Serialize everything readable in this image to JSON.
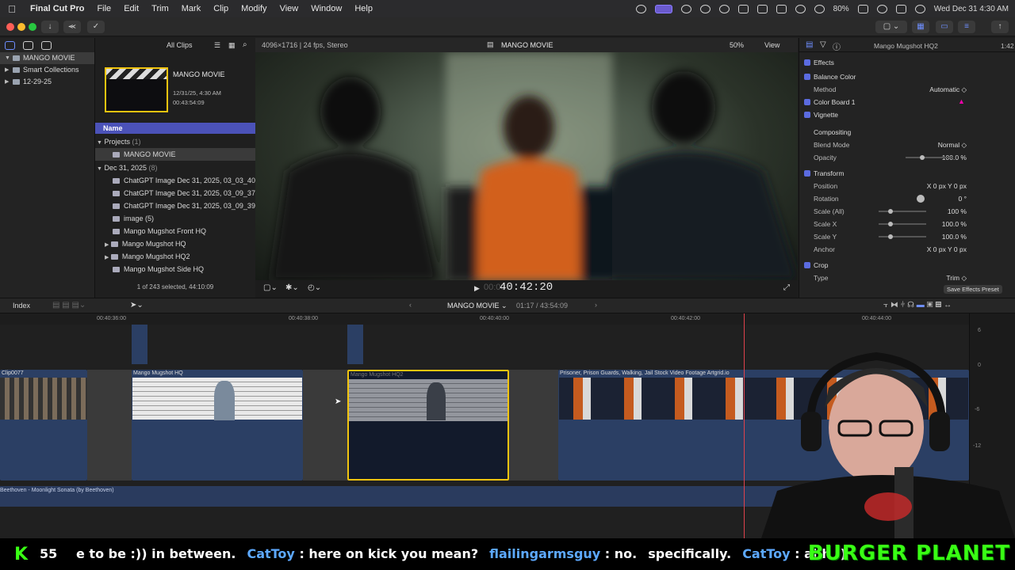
{
  "menubar": {
    "app_name": "Final Cut Pro",
    "items": [
      "File",
      "Edit",
      "Trim",
      "Mark",
      "Clip",
      "Modify",
      "View",
      "Window",
      "Help"
    ],
    "battery": "80%",
    "datetime": "Wed Dec 31  4:30 AM"
  },
  "sidebar": {
    "items": [
      {
        "label": "MANGO MOVIE"
      },
      {
        "label": "Smart Collections"
      },
      {
        "label": "12-29-25"
      }
    ]
  },
  "browser": {
    "filter": "All Clips",
    "project_title": "MANGO MOVIE",
    "project_date": "12/31/25, 4:30 AM",
    "project_duration": "00:43:54:09",
    "column_name": "Name",
    "group_projects": "Projects",
    "group_projects_count": "(1)",
    "project_row": "MANGO MOVIE",
    "group_date": "Dec 31, 2025",
    "group_date_count": "(8)",
    "rows": [
      "ChatGPT Image Dec 31, 2025, 03_03_40",
      "ChatGPT Image Dec 31, 2025, 03_09_37",
      "ChatGPT Image Dec 31, 2025, 03_09_39",
      "image (5)",
      "Mango Mugshot Front HQ",
      "Mango Mugshot HQ",
      "Mango Mugshot HQ2",
      "Mango Mugshot Side HQ"
    ],
    "status": "1 of 243 selected, 44:10:09"
  },
  "viewer": {
    "format": "4096×1716 | 24 fps, Stereo",
    "title": "MANGO MOVIE",
    "zoom": "50%",
    "view": "View",
    "timecode": "40:42:20",
    "timecode_prefix": "00:00"
  },
  "inspector": {
    "clip_name": "Mango Mugshot HQ2",
    "clip_time": "1:42",
    "rows": [
      {
        "label": "Effects",
        "value": ""
      },
      {
        "label": "Balance Color",
        "value": ""
      },
      {
        "label": "Method",
        "value": "Automatic ◇"
      },
      {
        "label": "Color Board 1",
        "value": ""
      },
      {
        "label": "Vignette",
        "value": ""
      },
      {
        "label": "Compositing",
        "value": ""
      },
      {
        "label": "Blend Mode",
        "value": "Normal ◇"
      },
      {
        "label": "Opacity",
        "value": "100.0  %"
      },
      {
        "label": "Transform",
        "value": ""
      },
      {
        "label": "Position",
        "value": "X    0 px    Y    0 px"
      },
      {
        "label": "Rotation",
        "value": "0 °"
      },
      {
        "label": "Scale (All)",
        "value": "100  %"
      },
      {
        "label": "Scale X",
        "value": "100.0  %"
      },
      {
        "label": "Scale Y",
        "value": "100.0  %"
      },
      {
        "label": "Anchor",
        "value": "X    0 px    Y    0 px"
      },
      {
        "label": "Crop",
        "value": ""
      },
      {
        "label": "Type",
        "value": "Trim ◇"
      }
    ],
    "save_preset": "Save Effects Preset"
  },
  "timeline": {
    "index": "Index",
    "project": "MANGO MOVIE",
    "position": "01:17 / 43:54:09",
    "ruler": [
      "00:40:36:00",
      "00:40:38:00",
      "00:40:40:00",
      "00:40:42:00",
      "00:40:44:00"
    ],
    "clips": [
      {
        "name": "Clip0077"
      },
      {
        "name": "Mango Mugshot HQ"
      },
      {
        "name": "Mango Mugshot HQ2"
      },
      {
        "name": "Prisoner, Prison Guards, Walking, Jail   Stock Video Footage   Artgrid.io"
      }
    ],
    "audio": "Beethoven - Moonlight Sonata (by Beethoven)",
    "meter_labels": [
      "6",
      "0",
      "-6",
      "-12"
    ]
  },
  "ticker": {
    "k_count": "55",
    "segments": [
      {
        "user": "",
        "text": "e to be :)) in between."
      },
      {
        "user": "CatToy",
        "text": ": here on kick you mean?"
      },
      {
        "user": "flailingarmsguy",
        "text": ": no."
      },
      {
        "user": "",
        "text": "specifically."
      },
      {
        "user": "CatToy",
        "text": ": ahh :)"
      }
    ],
    "brand": "BURGER PLANET"
  },
  "colors": {
    "accent": "#4b52b8",
    "selection": "#f1c40f",
    "playhead": "#e0424c",
    "brand": "#39ff14"
  }
}
